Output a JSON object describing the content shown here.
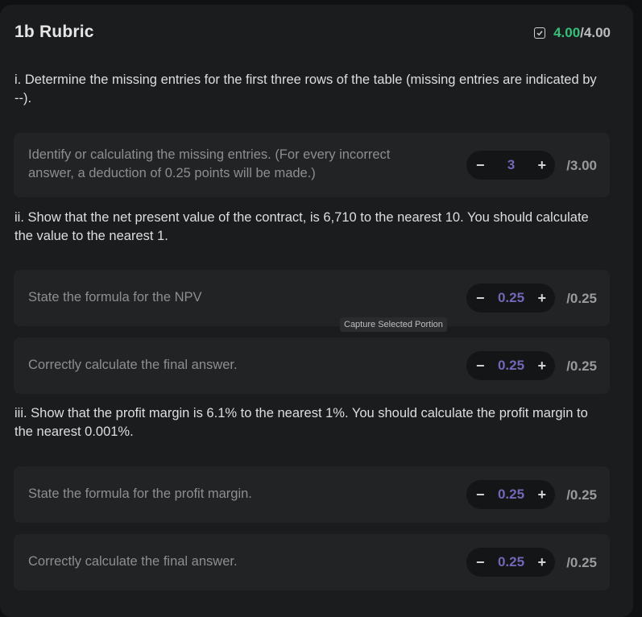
{
  "header": {
    "title": "1b Rubric",
    "score_earned": "4.00",
    "score_sep": "/",
    "score_max": "4.00"
  },
  "questions": [
    {
      "text": "i. Determine the missing entries for the first three rows of the table (missing entries are indicated by --).",
      "criteria": [
        {
          "text": "Identify or calculating the missing entries. (For every incorrect answer, a deduction of 0.25 points will be made.)",
          "value": "3",
          "max": "/3.00"
        }
      ]
    },
    {
      "text": "ii. Show that the net present value of the contract, is 6,710 to the nearest 10. You should calculate the value to the nearest 1.",
      "criteria": [
        {
          "text": "State the formula for the NPV",
          "value": "0.25",
          "max": "/0.25"
        },
        {
          "text": "Correctly calculate the final answer.",
          "value": "0.25",
          "max": "/0.25"
        }
      ]
    },
    {
      "text": "iii. Show that the profit margin is 6.1% to the nearest 1%. You should calculate the profit margin to the nearest 0.001%.",
      "criteria": [
        {
          "text": "State the formula for the profit margin.",
          "value": "0.25",
          "max": "/0.25"
        },
        {
          "text": "Correctly calculate the final answer.",
          "value": "0.25",
          "max": "/0.25"
        }
      ]
    }
  ],
  "stepper": {
    "minus": "−",
    "plus": "+"
  },
  "tooltip": "Capture Selected Portion",
  "colors": {
    "earned": "#34c07a",
    "stepper_value": "#7267b8",
    "panel": "#1b1c1e",
    "card": "#222325"
  }
}
